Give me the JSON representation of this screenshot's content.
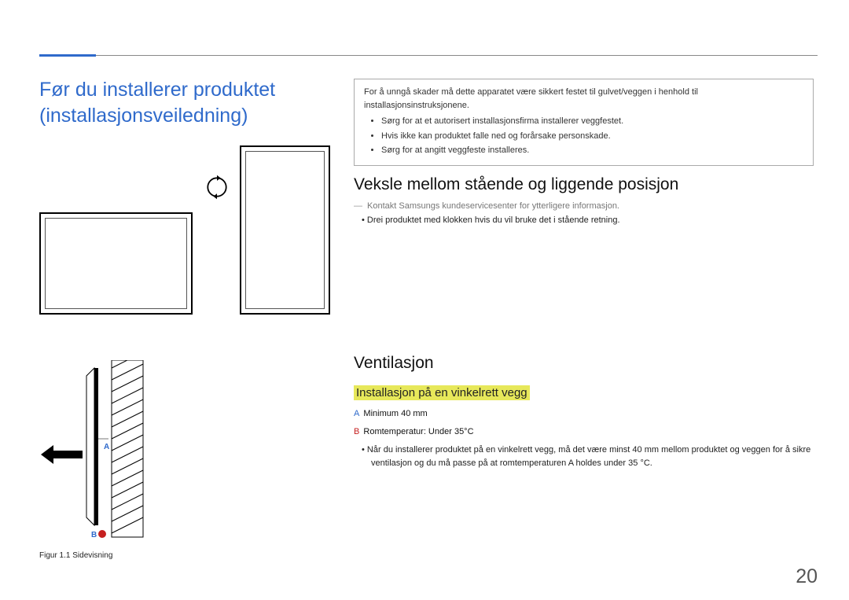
{
  "page_number": "20",
  "main_title": "Før du installerer produktet (installasjonsveiledning)",
  "info_box": {
    "intro": "For å unngå skader må dette apparatet være sikkert festet til gulvet/veggen i henhold til installasjonsinstruksjonene.",
    "items": [
      "Sørg for at et autorisert installasjonsfirma installerer veggfestet.",
      "Hvis ikke kan produktet falle ned og forårsake personskade.",
      "Sørg for at angitt veggfeste installeres."
    ]
  },
  "section_orientation": {
    "title": "Veksle mellom stående og liggende posisjon",
    "note": "Kontakt Samsungs kundeservicesenter for ytterligere informasjon.",
    "bullet": "Drei produktet med klokken hvis du vil bruke det i stående retning."
  },
  "section_ventilation": {
    "title": "Ventilasjon",
    "subtitle": "Installasjon på en vinkelrett vegg",
    "spec_a_label": "A",
    "spec_a_text": "Minimum 40 mm",
    "spec_b_label": "B",
    "spec_b_text": "Romtemperatur: Under 35°C",
    "bullet": "Når du installerer produktet på en vinkelrett vegg, må det være minst 40 mm mellom produktet og veggen for å sikre ventilasjon og du må passe på at romtemperaturen A holdes under 35 °C."
  },
  "figure": {
    "caption": "Figur 1.1 Sidevisning",
    "label_a": "A",
    "label_b": "B"
  }
}
